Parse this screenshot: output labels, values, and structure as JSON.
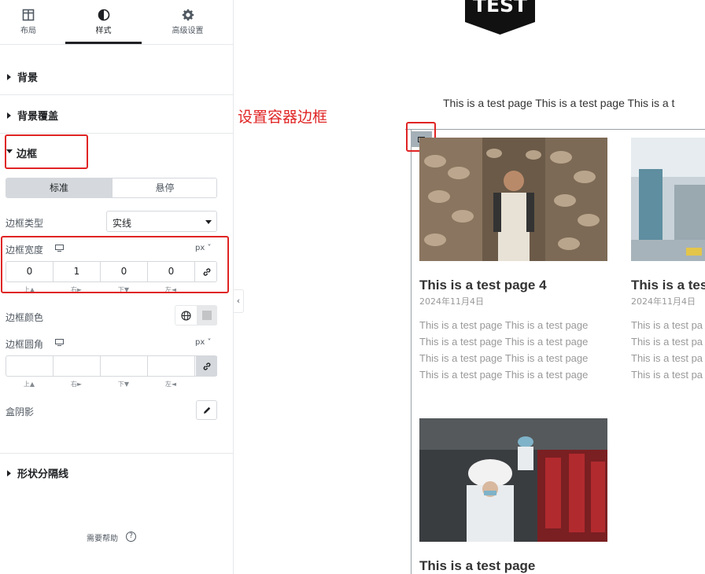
{
  "tabs": [
    {
      "label": "布局",
      "icon": "layout-icon"
    },
    {
      "label": "样式",
      "icon": "half-circle-icon"
    },
    {
      "label": "高级设置",
      "icon": "gear-icon"
    }
  ],
  "sections": {
    "background": "背景",
    "background_overlay": "背景覆盖",
    "border": "边框",
    "shape_divider": "形状分隔线"
  },
  "state_switch": {
    "normal": "标准",
    "hover": "悬停"
  },
  "border_type": {
    "label": "边框类型",
    "value": "实线"
  },
  "border_width": {
    "label": "边框宽度",
    "unit": "px",
    "values": [
      "0",
      "1",
      "0",
      "0"
    ],
    "sides": [
      "上▲",
      "右►",
      "下▼",
      "左◄"
    ]
  },
  "border_color": {
    "label": "边框颜色",
    "swatch": "#c2c4c6"
  },
  "border_radius": {
    "label": "边框圆角",
    "unit": "px",
    "values": [
      "",
      "",
      "",
      ""
    ],
    "sides": [
      "上▲",
      "右►",
      "下▼",
      "左◄"
    ]
  },
  "box_shadow": {
    "label": "盒阴影"
  },
  "help": {
    "label": "需要帮助",
    "icon": "?"
  },
  "collapse_icon": "‹",
  "annotation": "设置容器边框",
  "preview": {
    "badge_text": "TEST",
    "intro": "This is a test page This is a test page This is a t",
    "posts": [
      {
        "title": "This is a test page 4",
        "date": "2024年11月4日",
        "excerpt": [
          "This is a test page This is a test page",
          "This is a test page This is a test page",
          "This is a test page This is a test page",
          "This is a test page This is a test page"
        ]
      },
      {
        "title": "This is a tes",
        "date": "2024年11月4日",
        "excerpt": [
          "This is a test pa",
          "This is a test pa",
          "This is a test pa",
          "This is a test pa"
        ]
      },
      {
        "title": "This is a test page"
      }
    ]
  },
  "colors": {
    "accent_red": "#e02424",
    "panel_border": "#e6e8ea",
    "control_border": "#d5d8dc"
  }
}
